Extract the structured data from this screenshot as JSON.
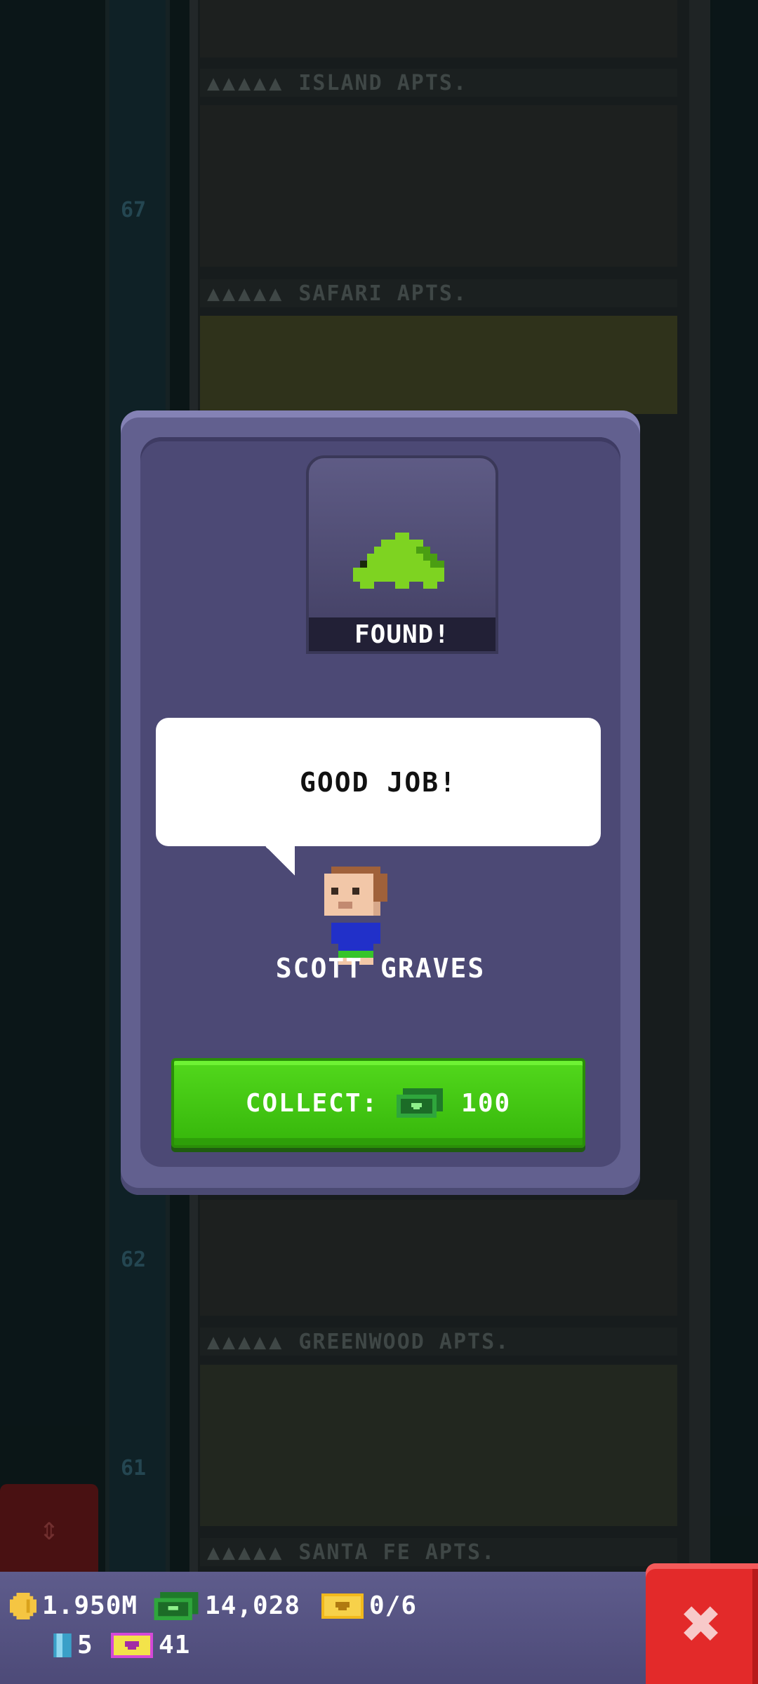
{
  "tower": {
    "floors": [
      {
        "number": "67",
        "label": "SAFARI APTS."
      },
      {
        "number": "62",
        "label": "GREENWOOD APTS."
      },
      {
        "number": "61",
        "label": "SANTA FE APTS."
      }
    ],
    "top_floor_label": "ISLAND APTS."
  },
  "modal": {
    "found_label": "FOUND!",
    "item_icon": "green-stegosaurus-icon",
    "message": "GOOD JOB!",
    "person_name": "SCOTT GRAVES",
    "collect": {
      "label": "COLLECT:",
      "currency_icon": "bux-icon",
      "amount": "100"
    }
  },
  "status_bar": {
    "coins": "1.950M",
    "bux": "14,028",
    "tickets": "0/6",
    "keys": "5",
    "vip": "41"
  },
  "colors": {
    "modal_bg": "#4c4975",
    "collect_green": "#44c712",
    "close_red": "#e32a2a"
  }
}
